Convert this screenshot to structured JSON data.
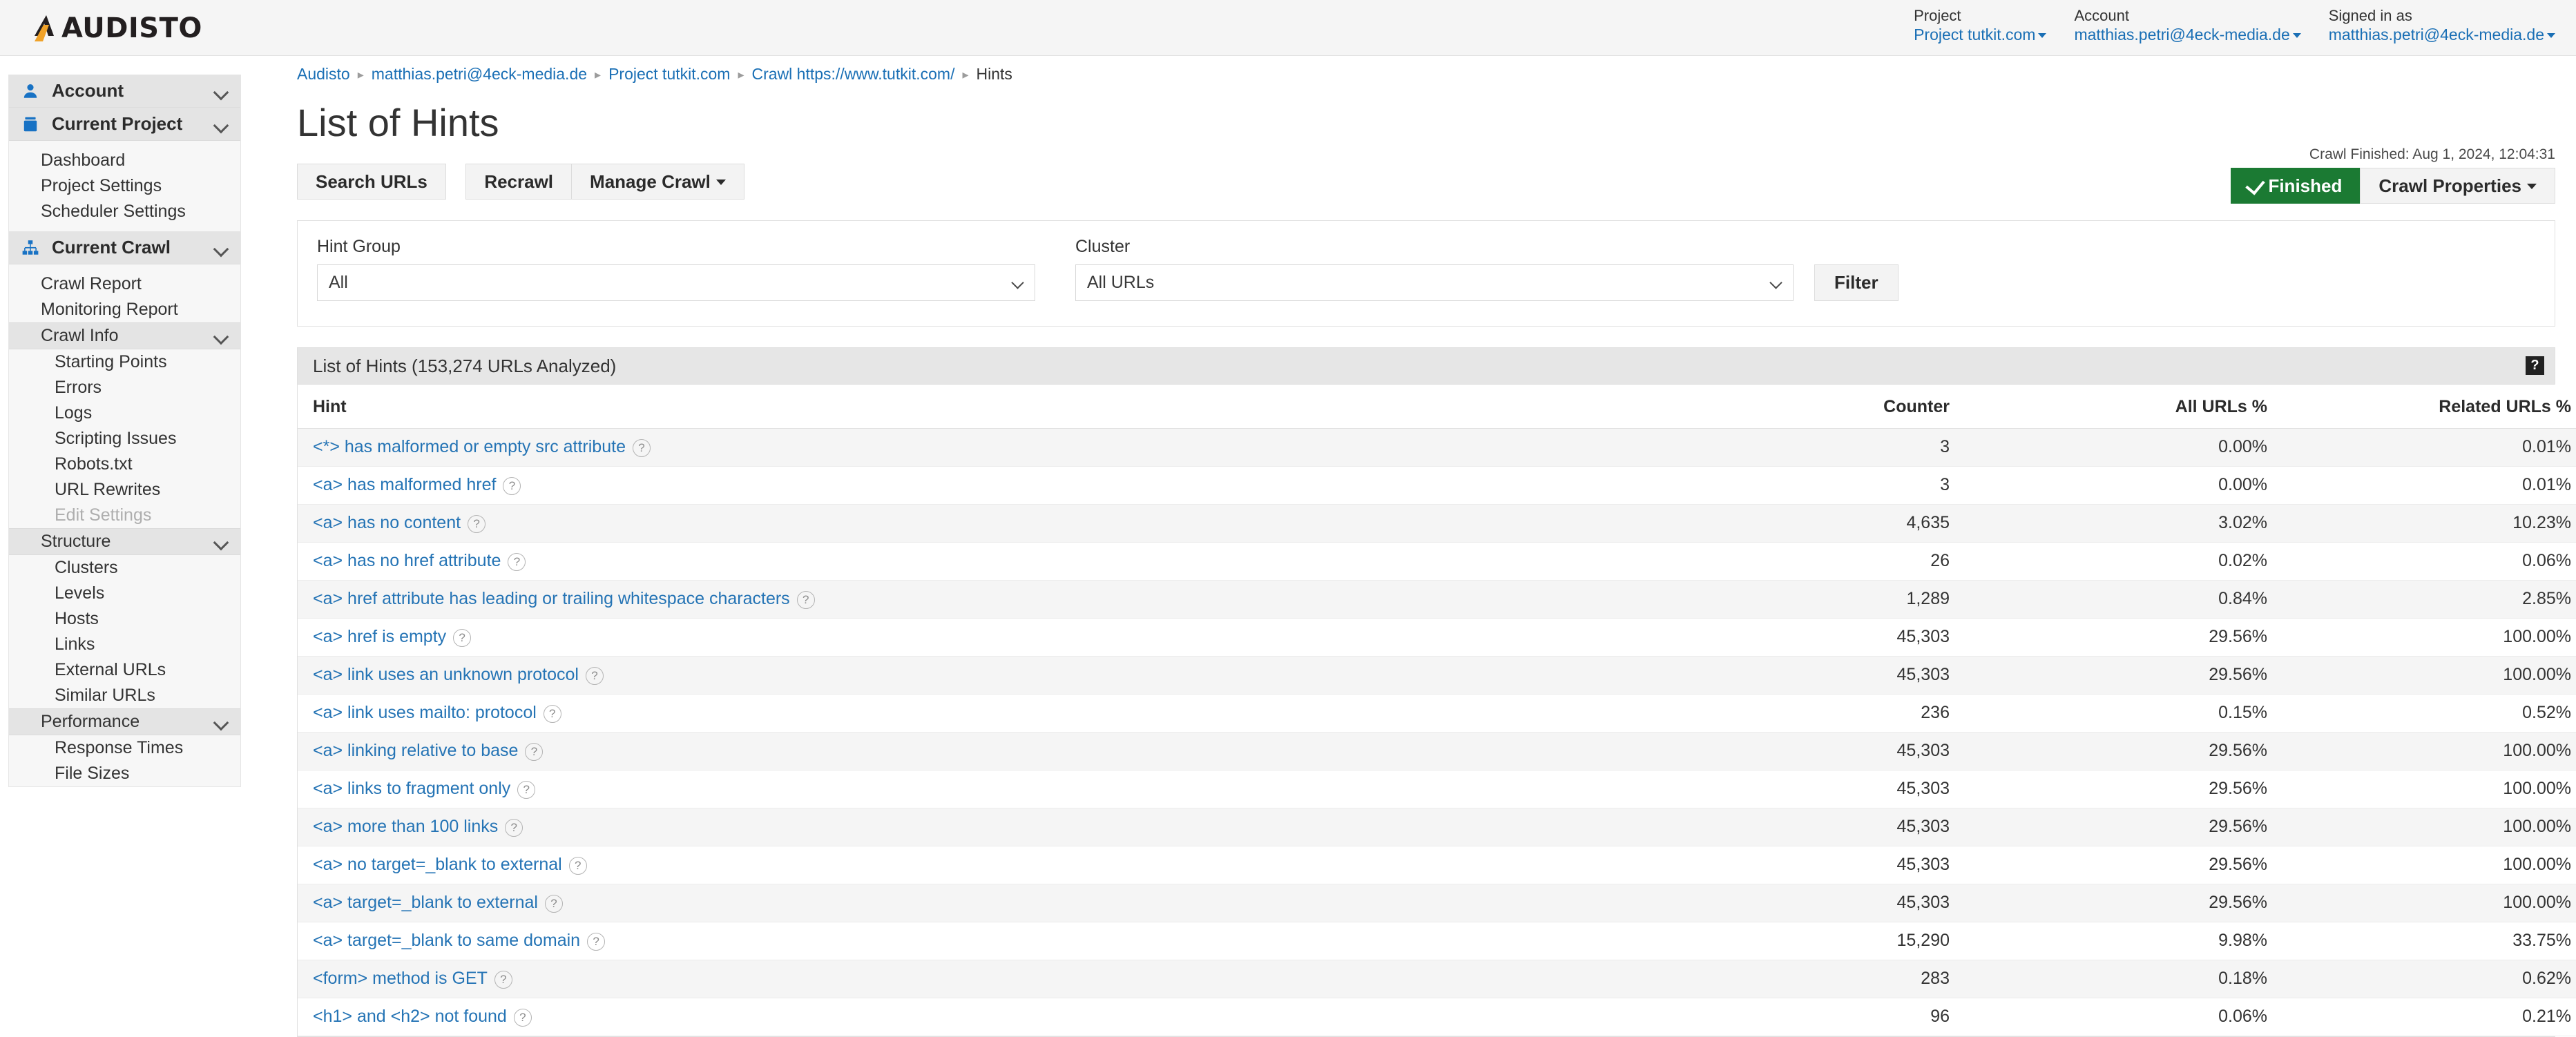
{
  "brand": {
    "name": "AUDISTO",
    "logo_icon": "audisto-a-mark"
  },
  "header": {
    "project": {
      "label": "Project",
      "value": "Project tutkit.com"
    },
    "account": {
      "label": "Account",
      "value": "matthias.petri@4eck-media.de"
    },
    "signed_in": {
      "label": "Signed in as",
      "value": "matthias.petri@4eck-media.de"
    }
  },
  "sidebar": {
    "sections": [
      {
        "type": "header",
        "label": "Account",
        "icon": "user-icon",
        "collapsed_chevron": "chevron-down-icon"
      },
      {
        "type": "header",
        "label": "Current Project",
        "icon": "briefcase-icon",
        "collapsed_chevron": "chevron-down-icon"
      },
      {
        "type": "item",
        "label": "Dashboard",
        "level": 1
      },
      {
        "type": "item",
        "label": "Project Settings",
        "level": 1
      },
      {
        "type": "item",
        "label": "Scheduler Settings",
        "level": 1
      },
      {
        "type": "header",
        "label": "Current Crawl",
        "icon": "sitemap-icon",
        "collapsed_chevron": "chevron-down-icon"
      },
      {
        "type": "item",
        "label": "Crawl Report",
        "level": 1
      },
      {
        "type": "item",
        "label": "Monitoring Report",
        "level": 1
      },
      {
        "type": "group",
        "label": "Crawl Info",
        "chevron": "chevron-down-icon"
      },
      {
        "type": "item",
        "label": "Starting Points",
        "level": 2
      },
      {
        "type": "item",
        "label": "Errors",
        "level": 2
      },
      {
        "type": "item",
        "label": "Logs",
        "level": 2
      },
      {
        "type": "item",
        "label": "Scripting Issues",
        "level": 2
      },
      {
        "type": "item",
        "label": "Robots.txt",
        "level": 2
      },
      {
        "type": "item",
        "label": "URL Rewrites",
        "level": 2
      },
      {
        "type": "item",
        "label": "Edit Settings",
        "level": 2,
        "disabled": true
      },
      {
        "type": "group",
        "label": "Structure",
        "chevron": "chevron-down-icon"
      },
      {
        "type": "item",
        "label": "Clusters",
        "level": 2
      },
      {
        "type": "item",
        "label": "Levels",
        "level": 2
      },
      {
        "type": "item",
        "label": "Hosts",
        "level": 2
      },
      {
        "type": "item",
        "label": "Links",
        "level": 2
      },
      {
        "type": "item",
        "label": "External URLs",
        "level": 2
      },
      {
        "type": "item",
        "label": "Similar URLs",
        "level": 2
      },
      {
        "type": "group",
        "label": "Performance",
        "chevron": "chevron-down-icon"
      },
      {
        "type": "item",
        "label": "Response Times",
        "level": 2
      },
      {
        "type": "item",
        "label": "File Sizes",
        "level": 2
      }
    ]
  },
  "breadcrumb": {
    "items": [
      "Audisto",
      "matthias.petri@4eck-media.de",
      "Project tutkit.com",
      "Crawl https://www.tutkit.com/",
      "Hints"
    ],
    "separator": "▸"
  },
  "page": {
    "title": "List of Hints"
  },
  "toolbar": {
    "search_urls_label": "Search URLs",
    "recrawl_label": "Recrawl",
    "manage_crawl_label": "Manage Crawl"
  },
  "crawl_status": {
    "finished_text": "Crawl Finished: Aug 1, 2024, 12:04:31",
    "badge_label": "Finished",
    "badge_color": "#1b7a33",
    "properties_label": "Crawl Properties"
  },
  "filters": {
    "hint_group": {
      "label": "Hint Group",
      "value": "All"
    },
    "cluster": {
      "label": "Cluster",
      "value": "All URLs"
    },
    "filter_button": "Filter"
  },
  "table": {
    "panel_title": "List of Hints (153,274 URLs Analyzed)",
    "help_glyph": "?",
    "columns": [
      "Hint",
      "Counter",
      "All URLs %",
      "Related URLs %"
    ],
    "rows": [
      {
        "hint": "<*> has malformed or empty src attribute",
        "counter": "3",
        "all_urls_pct": "0.00%",
        "related_urls_pct": "0.01%"
      },
      {
        "hint": "<a> has malformed href",
        "counter": "3",
        "all_urls_pct": "0.00%",
        "related_urls_pct": "0.01%"
      },
      {
        "hint": "<a> has no content",
        "counter": "4,635",
        "all_urls_pct": "3.02%",
        "related_urls_pct": "10.23%"
      },
      {
        "hint": "<a> has no href attribute",
        "counter": "26",
        "all_urls_pct": "0.02%",
        "related_urls_pct": "0.06%"
      },
      {
        "hint": "<a> href attribute has leading or trailing whitespace characters",
        "counter": "1,289",
        "all_urls_pct": "0.84%",
        "related_urls_pct": "2.85%"
      },
      {
        "hint": "<a> href is empty",
        "counter": "45,303",
        "all_urls_pct": "29.56%",
        "related_urls_pct": "100.00%"
      },
      {
        "hint": "<a> link uses an unknown protocol",
        "counter": "45,303",
        "all_urls_pct": "29.56%",
        "related_urls_pct": "100.00%"
      },
      {
        "hint": "<a> link uses mailto: protocol",
        "counter": "236",
        "all_urls_pct": "0.15%",
        "related_urls_pct": "0.52%"
      },
      {
        "hint": "<a> linking relative to base",
        "counter": "45,303",
        "all_urls_pct": "29.56%",
        "related_urls_pct": "100.00%"
      },
      {
        "hint": "<a> links to fragment only",
        "counter": "45,303",
        "all_urls_pct": "29.56%",
        "related_urls_pct": "100.00%"
      },
      {
        "hint": "<a> more than 100 links",
        "counter": "45,303",
        "all_urls_pct": "29.56%",
        "related_urls_pct": "100.00%"
      },
      {
        "hint": "<a> no target=_blank to external",
        "counter": "45,303",
        "all_urls_pct": "29.56%",
        "related_urls_pct": "100.00%"
      },
      {
        "hint": "<a> target=_blank to external",
        "counter": "45,303",
        "all_urls_pct": "29.56%",
        "related_urls_pct": "100.00%"
      },
      {
        "hint": "<a> target=_blank to same domain",
        "counter": "15,290",
        "all_urls_pct": "9.98%",
        "related_urls_pct": "33.75%"
      },
      {
        "hint": "<form> method is GET",
        "counter": "283",
        "all_urls_pct": "0.18%",
        "related_urls_pct": "0.62%"
      },
      {
        "hint": "<h1> and <h2> not found",
        "counter": "96",
        "all_urls_pct": "0.06%",
        "related_urls_pct": "0.21%"
      }
    ]
  }
}
